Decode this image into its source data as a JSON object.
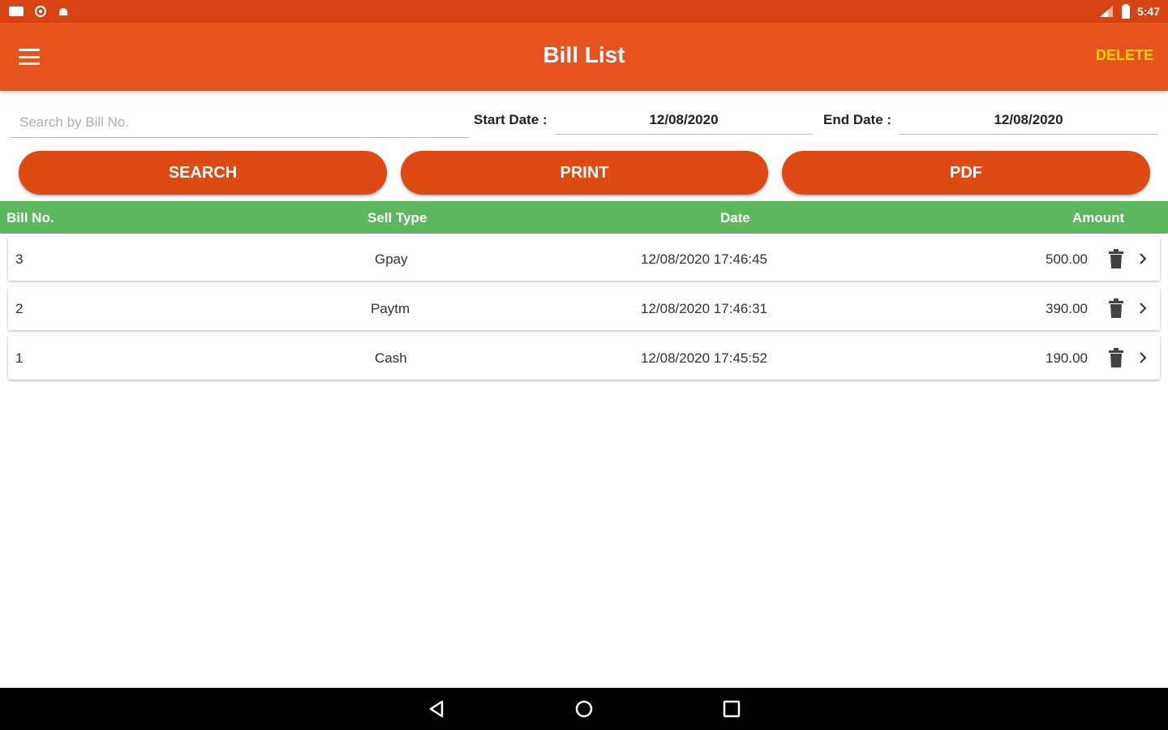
{
  "status": {
    "time": "5:47"
  },
  "app_bar": {
    "title": "Bill List",
    "delete_label": "DELETE"
  },
  "filters": {
    "search_placeholder": "Search by Bill No.",
    "start_label": "Start Date :",
    "start_value": "12/08/2020",
    "end_label": "End Date :",
    "end_value": "12/08/2020"
  },
  "buttons": {
    "search": "SEARCH",
    "print": "PRINT",
    "pdf": "PDF"
  },
  "table": {
    "headers": {
      "bill_no": "Bill No.",
      "sell_type": "Sell Type",
      "date": "Date",
      "amount": "Amount"
    },
    "rows": [
      {
        "bill_no": "3",
        "sell_type": "Gpay",
        "date": "12/08/2020 17:46:45",
        "amount": "500.00"
      },
      {
        "bill_no": "2",
        "sell_type": "Paytm",
        "date": "12/08/2020 17:46:31",
        "amount": "390.00"
      },
      {
        "bill_no": "1",
        "sell_type": "Cash",
        "date": "12/08/2020 17:45:52",
        "amount": "190.00"
      }
    ]
  },
  "colors": {
    "primary": "#e6531f",
    "status": "#d84315",
    "button": "#dd4a14",
    "header": "#5cb85c",
    "accent": "#ffd600"
  }
}
